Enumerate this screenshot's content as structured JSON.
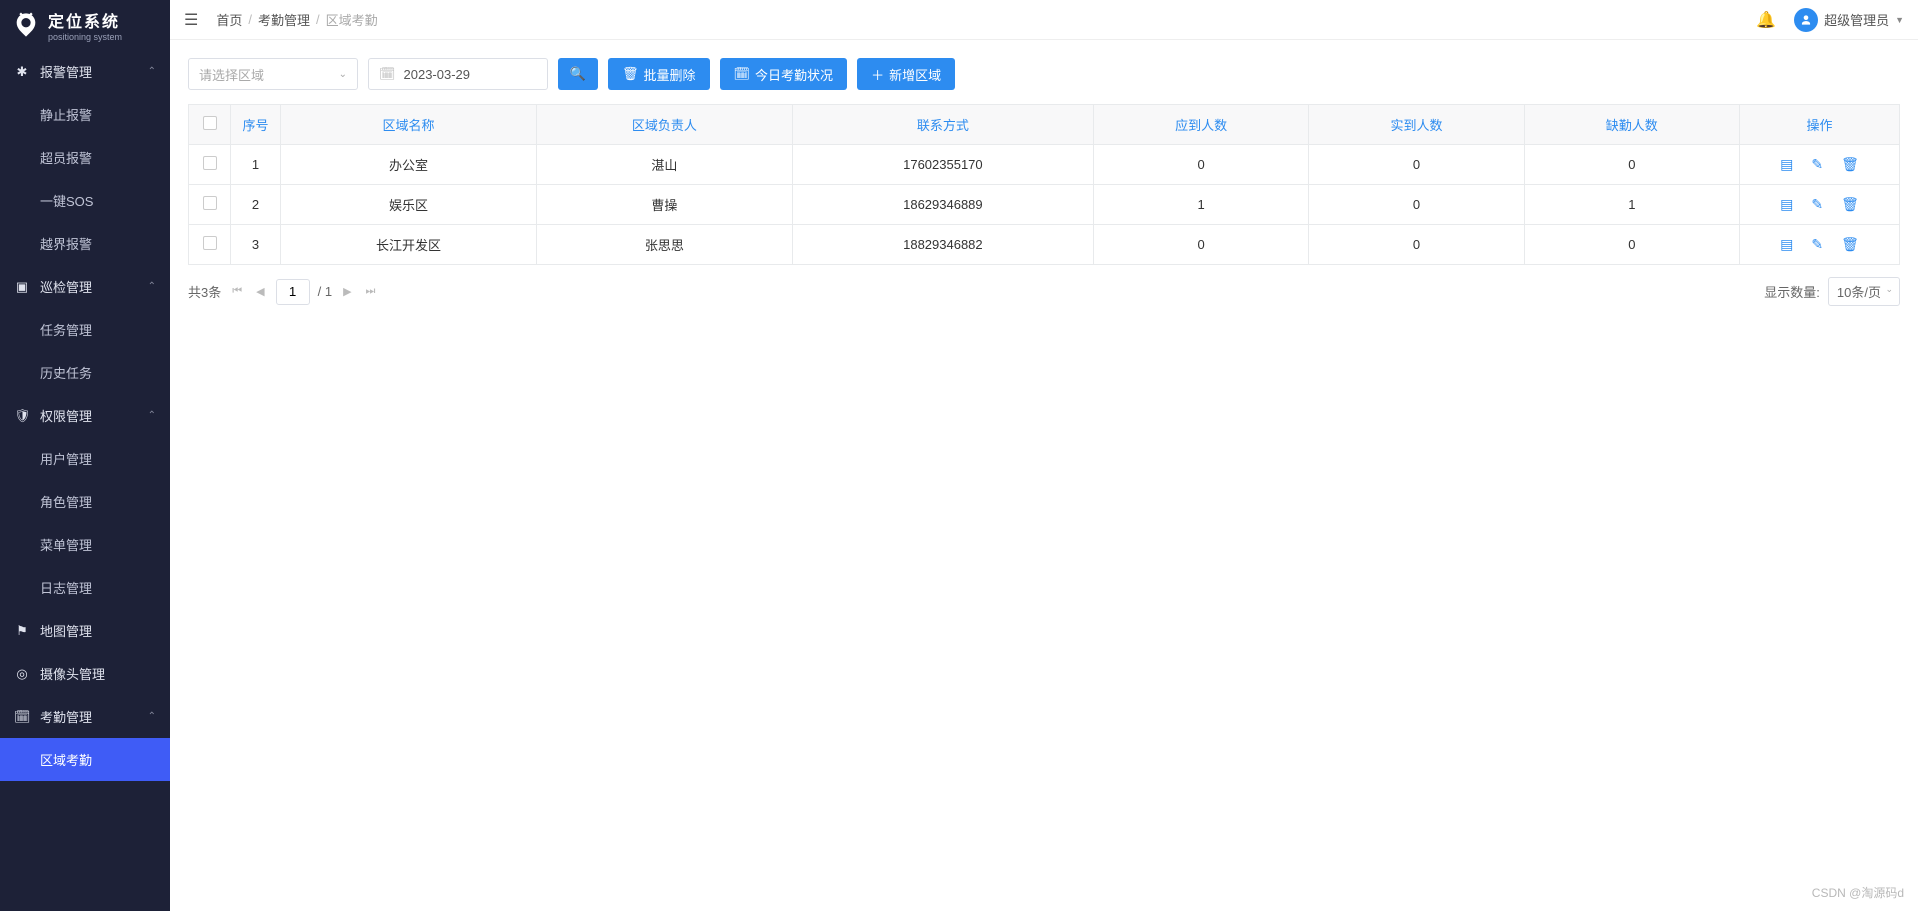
{
  "logo": {
    "cn": "定位系统",
    "en": "positioning system"
  },
  "sidebar": [
    {
      "label": "报警管理",
      "icon": "✱",
      "expandable": true,
      "children": [
        {
          "label": "静止报警"
        },
        {
          "label": "超员报警"
        },
        {
          "label": "一键SOS"
        },
        {
          "label": "越界报警"
        }
      ]
    },
    {
      "label": "巡检管理",
      "icon": "▣",
      "expandable": true,
      "children": [
        {
          "label": "任务管理"
        },
        {
          "label": "历史任务"
        }
      ]
    },
    {
      "label": "权限管理",
      "icon": "🛡",
      "expandable": true,
      "children": [
        {
          "label": "用户管理"
        },
        {
          "label": "角色管理"
        },
        {
          "label": "菜单管理"
        },
        {
          "label": "日志管理"
        }
      ]
    },
    {
      "label": "地图管理",
      "icon": "⚑",
      "expandable": false
    },
    {
      "label": "摄像头管理",
      "icon": "◎",
      "expandable": false
    },
    {
      "label": "考勤管理",
      "icon": "🗓",
      "expandable": true,
      "children": [
        {
          "label": "区域考勤",
          "active": true
        }
      ]
    }
  ],
  "breadcrumb": [
    "首页",
    "考勤管理",
    "区域考勤"
  ],
  "user": {
    "name": "超级管理员"
  },
  "filters": {
    "region_placeholder": "请选择区域",
    "date_value": "2023-03-29"
  },
  "buttons": {
    "batch_delete": "批量删除",
    "today_status": "今日考勤状况",
    "add_region": "新增区域"
  },
  "table": {
    "headers": [
      "序号",
      "区域名称",
      "区域负责人",
      "联系方式",
      "应到人数",
      "实到人数",
      "缺勤人数",
      "操作"
    ],
    "rows": [
      {
        "idx": "1",
        "name": "办公室",
        "owner": "湛山",
        "contact": "17602355170",
        "expected": "0",
        "actual": "0",
        "absent": "0"
      },
      {
        "idx": "2",
        "name": "娱乐区",
        "owner": "曹操",
        "contact": "18629346889",
        "expected": "1",
        "actual": "0",
        "absent": "1"
      },
      {
        "idx": "3",
        "name": "长江开发区",
        "owner": "张思思",
        "contact": "18829346882",
        "expected": "0",
        "actual": "0",
        "absent": "0"
      }
    ]
  },
  "pagination": {
    "total_text": "共3条",
    "page": "1",
    "total_pages_text": "/ 1",
    "size_label": "显示数量:",
    "size_value": "10条/页"
  },
  "watermark": "CSDN @淘源码d"
}
